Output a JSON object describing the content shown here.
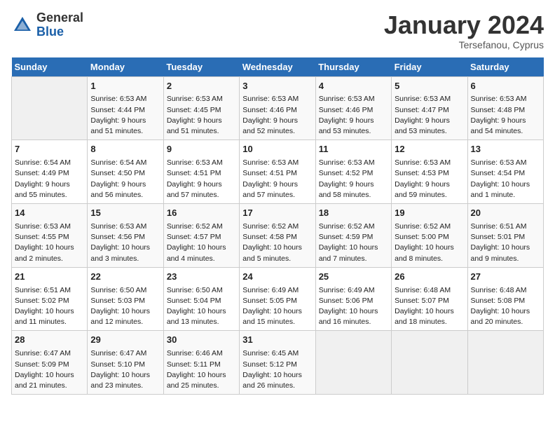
{
  "header": {
    "logo_general": "General",
    "logo_blue": "Blue",
    "month_title": "January 2024",
    "location": "Tersefanou, Cyprus"
  },
  "days_of_week": [
    "Sunday",
    "Monday",
    "Tuesday",
    "Wednesday",
    "Thursday",
    "Friday",
    "Saturday"
  ],
  "weeks": [
    [
      {
        "day": "",
        "info": ""
      },
      {
        "day": "1",
        "info": "Sunrise: 6:53 AM\nSunset: 4:44 PM\nDaylight: 9 hours\nand 51 minutes."
      },
      {
        "day": "2",
        "info": "Sunrise: 6:53 AM\nSunset: 4:45 PM\nDaylight: 9 hours\nand 51 minutes."
      },
      {
        "day": "3",
        "info": "Sunrise: 6:53 AM\nSunset: 4:46 PM\nDaylight: 9 hours\nand 52 minutes."
      },
      {
        "day": "4",
        "info": "Sunrise: 6:53 AM\nSunset: 4:46 PM\nDaylight: 9 hours\nand 53 minutes."
      },
      {
        "day": "5",
        "info": "Sunrise: 6:53 AM\nSunset: 4:47 PM\nDaylight: 9 hours\nand 53 minutes."
      },
      {
        "day": "6",
        "info": "Sunrise: 6:53 AM\nSunset: 4:48 PM\nDaylight: 9 hours\nand 54 minutes."
      }
    ],
    [
      {
        "day": "7",
        "info": "Sunrise: 6:54 AM\nSunset: 4:49 PM\nDaylight: 9 hours\nand 55 minutes."
      },
      {
        "day": "8",
        "info": "Sunrise: 6:54 AM\nSunset: 4:50 PM\nDaylight: 9 hours\nand 56 minutes."
      },
      {
        "day": "9",
        "info": "Sunrise: 6:53 AM\nSunset: 4:51 PM\nDaylight: 9 hours\nand 57 minutes."
      },
      {
        "day": "10",
        "info": "Sunrise: 6:53 AM\nSunset: 4:51 PM\nDaylight: 9 hours\nand 57 minutes."
      },
      {
        "day": "11",
        "info": "Sunrise: 6:53 AM\nSunset: 4:52 PM\nDaylight: 9 hours\nand 58 minutes."
      },
      {
        "day": "12",
        "info": "Sunrise: 6:53 AM\nSunset: 4:53 PM\nDaylight: 9 hours\nand 59 minutes."
      },
      {
        "day": "13",
        "info": "Sunrise: 6:53 AM\nSunset: 4:54 PM\nDaylight: 10 hours\nand 1 minute."
      }
    ],
    [
      {
        "day": "14",
        "info": "Sunrise: 6:53 AM\nSunset: 4:55 PM\nDaylight: 10 hours\nand 2 minutes."
      },
      {
        "day": "15",
        "info": "Sunrise: 6:53 AM\nSunset: 4:56 PM\nDaylight: 10 hours\nand 3 minutes."
      },
      {
        "day": "16",
        "info": "Sunrise: 6:52 AM\nSunset: 4:57 PM\nDaylight: 10 hours\nand 4 minutes."
      },
      {
        "day": "17",
        "info": "Sunrise: 6:52 AM\nSunset: 4:58 PM\nDaylight: 10 hours\nand 5 minutes."
      },
      {
        "day": "18",
        "info": "Sunrise: 6:52 AM\nSunset: 4:59 PM\nDaylight: 10 hours\nand 7 minutes."
      },
      {
        "day": "19",
        "info": "Sunrise: 6:52 AM\nSunset: 5:00 PM\nDaylight: 10 hours\nand 8 minutes."
      },
      {
        "day": "20",
        "info": "Sunrise: 6:51 AM\nSunset: 5:01 PM\nDaylight: 10 hours\nand 9 minutes."
      }
    ],
    [
      {
        "day": "21",
        "info": "Sunrise: 6:51 AM\nSunset: 5:02 PM\nDaylight: 10 hours\nand 11 minutes."
      },
      {
        "day": "22",
        "info": "Sunrise: 6:50 AM\nSunset: 5:03 PM\nDaylight: 10 hours\nand 12 minutes."
      },
      {
        "day": "23",
        "info": "Sunrise: 6:50 AM\nSunset: 5:04 PM\nDaylight: 10 hours\nand 13 minutes."
      },
      {
        "day": "24",
        "info": "Sunrise: 6:49 AM\nSunset: 5:05 PM\nDaylight: 10 hours\nand 15 minutes."
      },
      {
        "day": "25",
        "info": "Sunrise: 6:49 AM\nSunset: 5:06 PM\nDaylight: 10 hours\nand 16 minutes."
      },
      {
        "day": "26",
        "info": "Sunrise: 6:48 AM\nSunset: 5:07 PM\nDaylight: 10 hours\nand 18 minutes."
      },
      {
        "day": "27",
        "info": "Sunrise: 6:48 AM\nSunset: 5:08 PM\nDaylight: 10 hours\nand 20 minutes."
      }
    ],
    [
      {
        "day": "28",
        "info": "Sunrise: 6:47 AM\nSunset: 5:09 PM\nDaylight: 10 hours\nand 21 minutes."
      },
      {
        "day": "29",
        "info": "Sunrise: 6:47 AM\nSunset: 5:10 PM\nDaylight: 10 hours\nand 23 minutes."
      },
      {
        "day": "30",
        "info": "Sunrise: 6:46 AM\nSunset: 5:11 PM\nDaylight: 10 hours\nand 25 minutes."
      },
      {
        "day": "31",
        "info": "Sunrise: 6:45 AM\nSunset: 5:12 PM\nDaylight: 10 hours\nand 26 minutes."
      },
      {
        "day": "",
        "info": ""
      },
      {
        "day": "",
        "info": ""
      },
      {
        "day": "",
        "info": ""
      }
    ]
  ]
}
